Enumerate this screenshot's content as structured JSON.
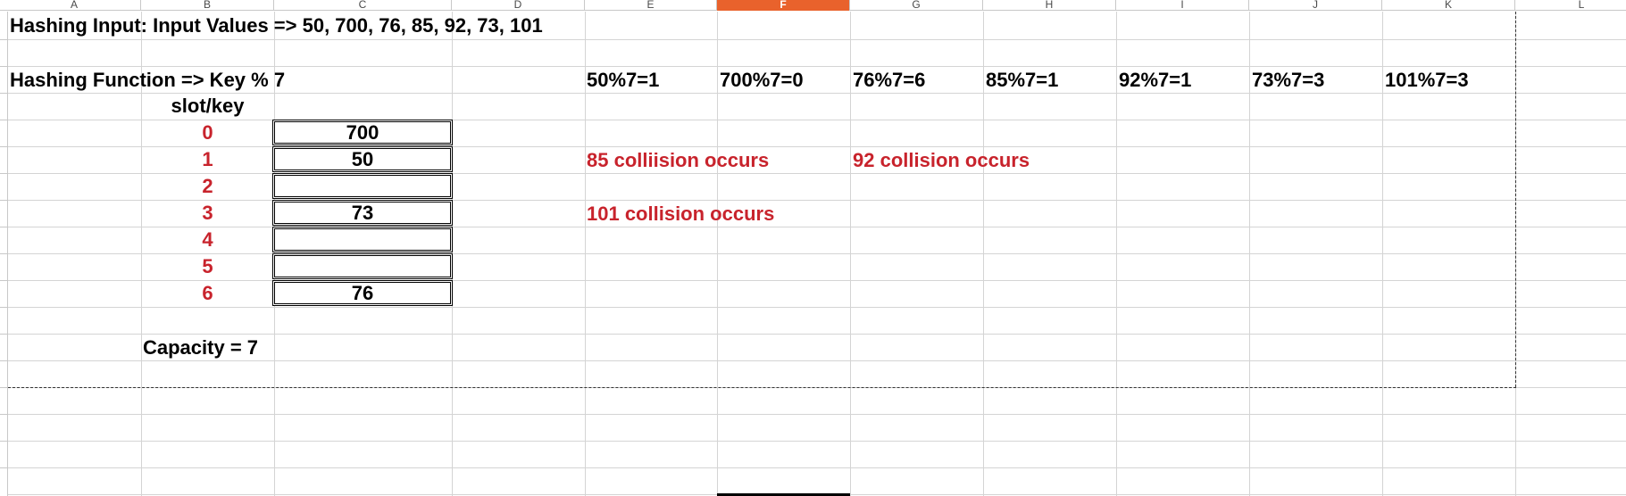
{
  "columns": [
    "A",
    "B",
    "C",
    "D",
    "E",
    "F",
    "G",
    "H",
    "I",
    "J",
    "K",
    "L"
  ],
  "active_column": "F",
  "cells": {
    "title": "Hashing Input: Input Values => 50, 700, 76, 85, 92, 73, 101",
    "hash_function": "Hashing Function => Key % 7",
    "slot_key_header": "slot/key",
    "capacity": "Capacity = 7"
  },
  "computations": [
    "50%7=1",
    "700%7=0",
    "76%7=6",
    "85%7=1",
    "92%7=1",
    "73%7=3",
    "101%7=3"
  ],
  "slots": [
    {
      "slot": "0",
      "key": "700"
    },
    {
      "slot": "1",
      "key": "50"
    },
    {
      "slot": "2",
      "key": ""
    },
    {
      "slot": "3",
      "key": "73"
    },
    {
      "slot": "4",
      "key": ""
    },
    {
      "slot": "5",
      "key": ""
    },
    {
      "slot": "6",
      "key": "76"
    }
  ],
  "collisions": [
    "85 colliision occurs",
    "92 collision occurs",
    "101 collision occurs"
  ],
  "colors": {
    "accent": "#e9622c",
    "text_red": "#c8232c",
    "grid": "#d4d4d4"
  }
}
